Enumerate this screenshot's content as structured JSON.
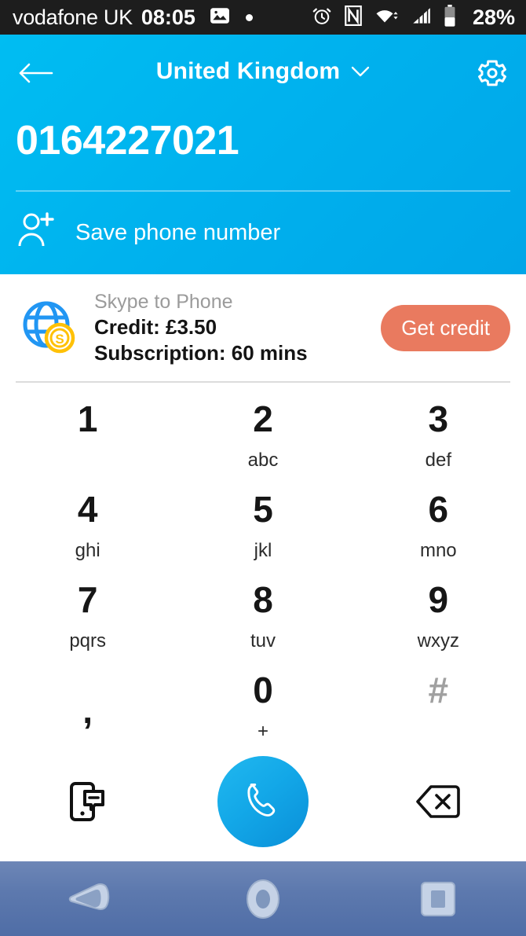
{
  "status_bar": {
    "carrier": "vodafone UK",
    "time": "08:05",
    "battery_percent": "28%",
    "left_icons": [
      "image-icon",
      "dot-indicator"
    ],
    "right_icons": [
      "alarm-icon",
      "nfc-icon",
      "wifi-icon",
      "signal-icon",
      "battery-icon"
    ]
  },
  "header": {
    "back_icon": "back-arrow-icon",
    "title": "United Kingdom",
    "dropdown_icon": "chevron-down-icon",
    "settings_icon": "gear-icon",
    "phone_number": "0164227021",
    "save_icon": "add-person-icon",
    "save_label": "Save phone number",
    "background_color": "#00b2ee"
  },
  "credit": {
    "icon": "globe-coin-icon",
    "title": "Skype to Phone",
    "credit_line": "Credit: £3.50",
    "subscription_line": "Subscription: 60 mins",
    "button_label": "Get credit",
    "button_color": "#e97a5f"
  },
  "keypad": {
    "keys": [
      {
        "digit": "1",
        "letters": ""
      },
      {
        "digit": "2",
        "letters": "abc"
      },
      {
        "digit": "3",
        "letters": "def"
      },
      {
        "digit": "4",
        "letters": "ghi"
      },
      {
        "digit": "5",
        "letters": "jkl"
      },
      {
        "digit": "6",
        "letters": "mno"
      },
      {
        "digit": "7",
        "letters": "pqrs"
      },
      {
        "digit": "8",
        "letters": "tuv"
      },
      {
        "digit": "9",
        "letters": "wxyz"
      },
      {
        "digit": ",",
        "letters": ""
      },
      {
        "digit": "0",
        "letters": "+"
      },
      {
        "digit": "#",
        "letters": ""
      }
    ]
  },
  "actions": {
    "sms_icon": "sms-phone-icon",
    "call_icon": "phone-handset-icon",
    "backspace_icon": "backspace-icon",
    "call_button_color": "#13a8e8"
  },
  "navbar": {
    "back_icon": "nav-back-icon",
    "home_icon": "nav-home-icon",
    "recents_icon": "nav-recents-icon"
  }
}
